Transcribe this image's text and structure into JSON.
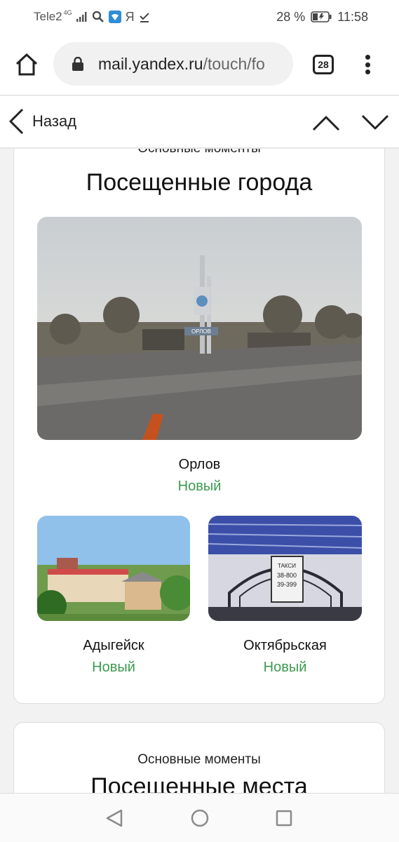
{
  "status_bar": {
    "carrier": "Tele2",
    "network": "4G",
    "ya_glyph": "Я",
    "battery": "28 %",
    "time": "11:58"
  },
  "browser": {
    "url_host": "mail.yandex.ru",
    "url_rest": "/touch/fo",
    "tab_count": "28"
  },
  "navbar": {
    "back_label": "Назад"
  },
  "card1": {
    "kicker": "Основные моменты",
    "title": "Посещенные города",
    "main_city": {
      "name": "Орлов",
      "badge": "Новый",
      "sign_text": "ОРЛОВ"
    },
    "cities": [
      {
        "name": "Адыгейск",
        "badge": "Новый"
      },
      {
        "name": "Октябрьская",
        "badge": "Новый",
        "sign_lines": [
          "ТАКСИ",
          "38-800",
          "39-399"
        ]
      }
    ]
  },
  "card2": {
    "kicker": "Основные моменты",
    "title": "Посещенные места"
  },
  "colors": {
    "accent_green": "#3c9a50",
    "background": "#f2f2f2"
  }
}
